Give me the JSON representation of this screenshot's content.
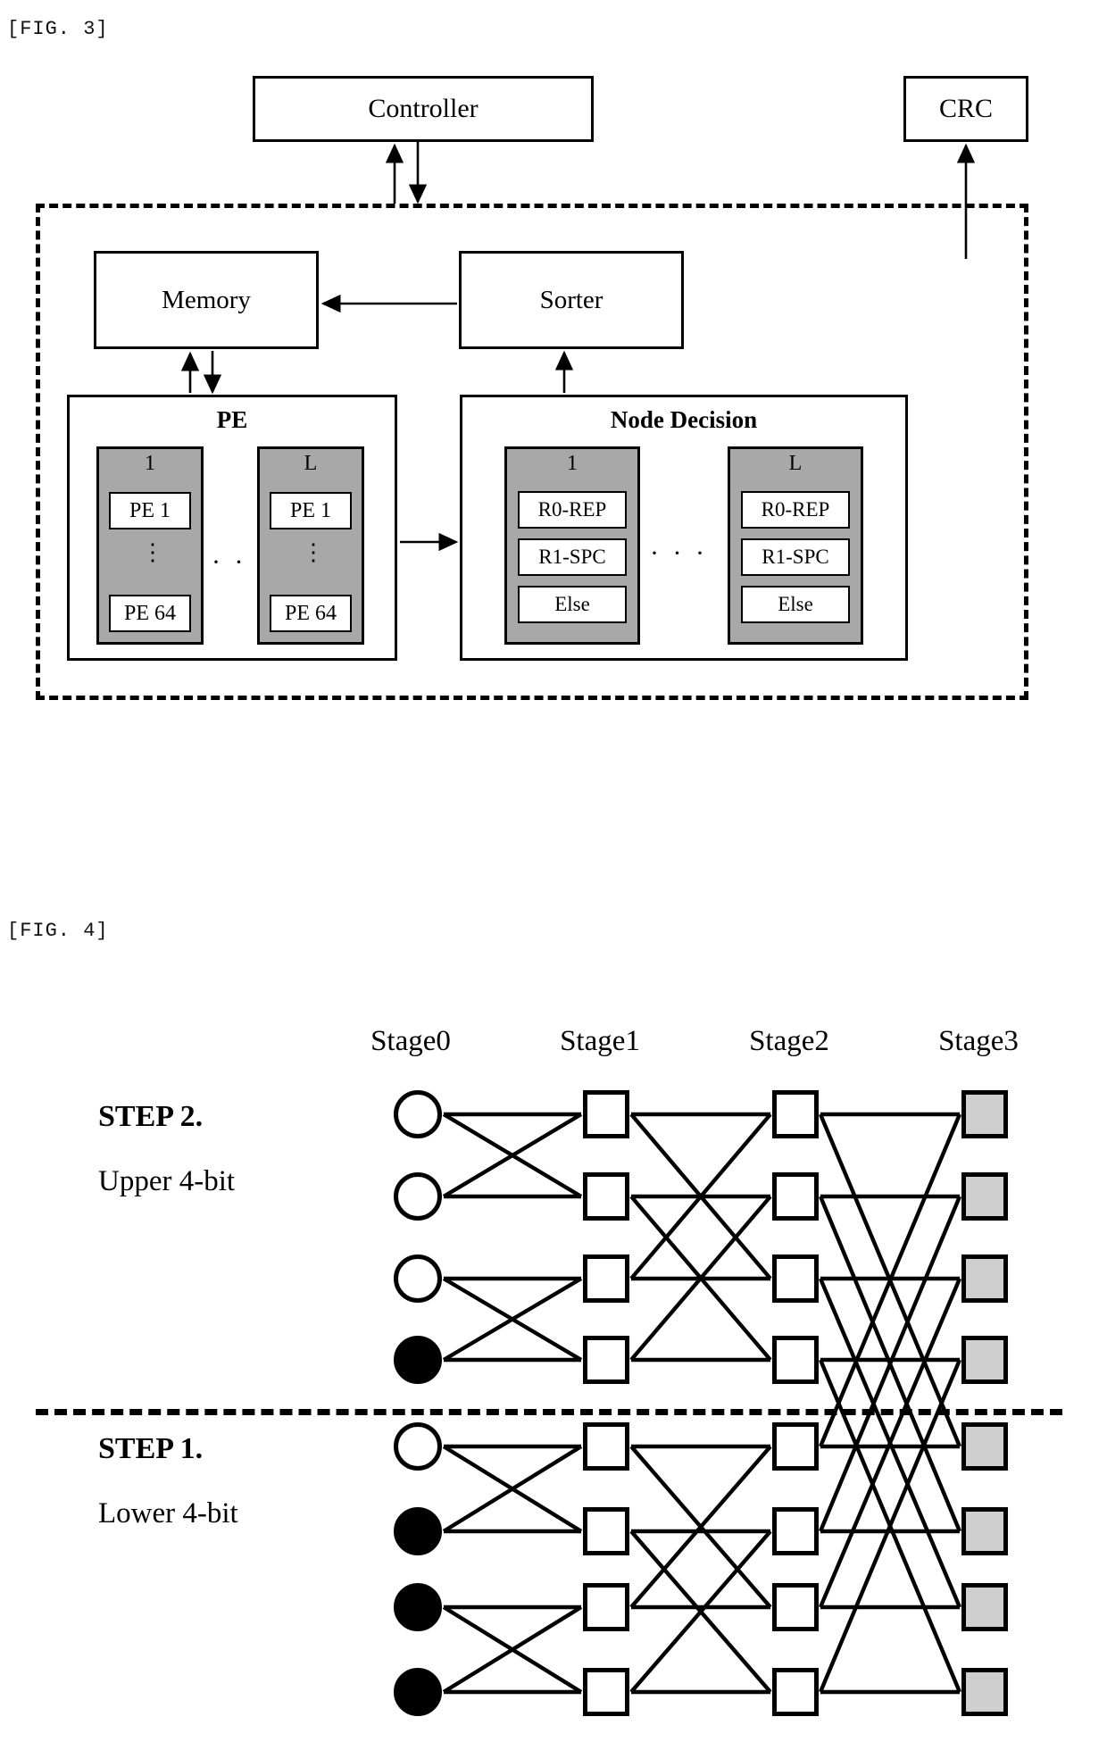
{
  "figures": [
    {
      "tag": "[FIG. 3]"
    },
    {
      "tag": "[FIG. 4]"
    }
  ],
  "fig3": {
    "tag": "[FIG. 3]",
    "controller": {
      "label": "Controller"
    },
    "crc": {
      "label": "CRC"
    },
    "memory": {
      "label": "Memory"
    },
    "sorter": {
      "label": "Sorter"
    },
    "pe_panel": {
      "title": "PE",
      "ellipsis": "· · ·",
      "groups": [
        {
          "index_label": "1",
          "first": "PE 1",
          "vdots": "⋮",
          "last": "PE 64"
        },
        {
          "index_label": "L",
          "first": "PE 1",
          "vdots": "⋮",
          "last": "PE 64"
        }
      ]
    },
    "node_decision_panel": {
      "title": "Node Decision",
      "ellipsis": "· · ·",
      "groups": [
        {
          "index_label": "1",
          "rows": [
            "R0-REP",
            "R1-SPC",
            "Else"
          ]
        },
        {
          "index_label": "L",
          "rows": [
            "R0-REP",
            "R1-SPC",
            "Else"
          ]
        }
      ]
    }
  },
  "fig4": {
    "tag": "[FIG. 4]",
    "stage_labels": [
      "Stage0",
      "Stage1",
      "Stage2",
      "Stage3"
    ],
    "steps": [
      {
        "title": "STEP 2.",
        "subtitle": "Upper 4-bit"
      },
      {
        "title": "STEP 1.",
        "subtitle": "Lower 4-bit"
      }
    ],
    "stage0_nodes_upper": [
      "white",
      "white",
      "white",
      "black"
    ],
    "stage0_nodes_lower": [
      "white",
      "black",
      "black",
      "black"
    ],
    "colors": {
      "outline": "#000000",
      "node_fill_white": "#ffffff",
      "node_fill_black": "#000000",
      "stage3_fill": "#cfcfcf",
      "gray_group_fill": "#a8a8a8"
    }
  }
}
